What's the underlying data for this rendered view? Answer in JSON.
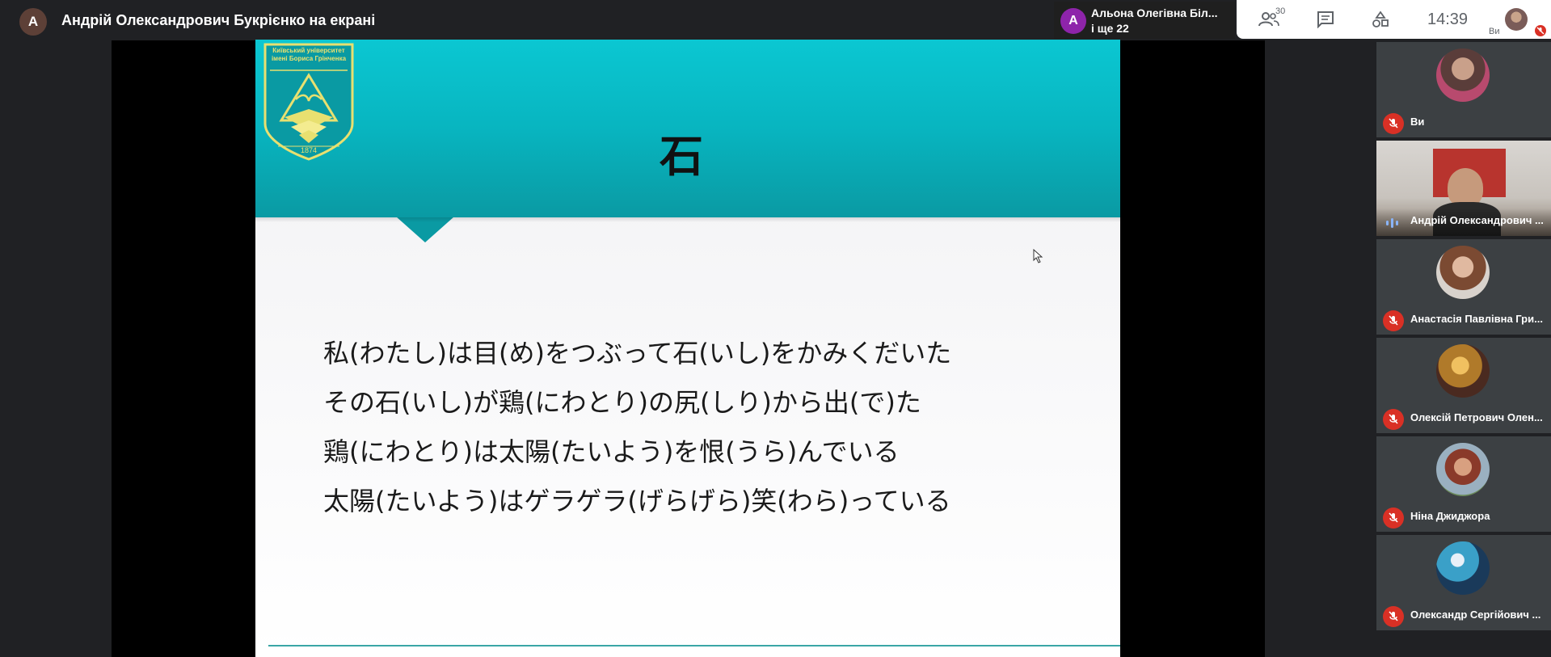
{
  "presenter": {
    "avatar_letter": "А",
    "title": "Андрій Олександрович Букрієнко на екрані"
  },
  "active_speaker": {
    "avatar_letter": "А",
    "name": "Альона Олегівна Біл...",
    "more": "і ще 22"
  },
  "controls": {
    "people_count": "30",
    "clock": "14:39",
    "self_label": "Ви"
  },
  "slide": {
    "logo_text_line1": "Київський університет",
    "logo_text_line2": "імені Бориса Грінченка",
    "logo_year": "1874",
    "title": "石",
    "lines": [
      "私(わたし)は目(め)をつぶって石(いし)をかみくだいた",
      "その石(いし)が鶏(にわとり)の尻(しり)から出(で)た",
      "鶏(にわとり)は太陽(たいよう)を恨(うら)んでいる",
      "太陽(たいよう)はゲラゲラ(げらげら)笑(わら)っている"
    ]
  },
  "participants": [
    {
      "name": "Ви",
      "muted": true
    },
    {
      "name": "Андрій Олександрович ...",
      "muted": false,
      "speaking": true
    },
    {
      "name": "Анастасія Павлівна Гри...",
      "muted": true
    },
    {
      "name": "Олексій Петрович Олен...",
      "muted": true
    },
    {
      "name": "Ніна Джиджора",
      "muted": true
    },
    {
      "name": "Олександр Сергійович ...",
      "muted": true
    }
  ],
  "colors": {
    "header_teal": "#0bc7d2",
    "mute_red": "#d93025",
    "panel_bg": "#202124"
  }
}
